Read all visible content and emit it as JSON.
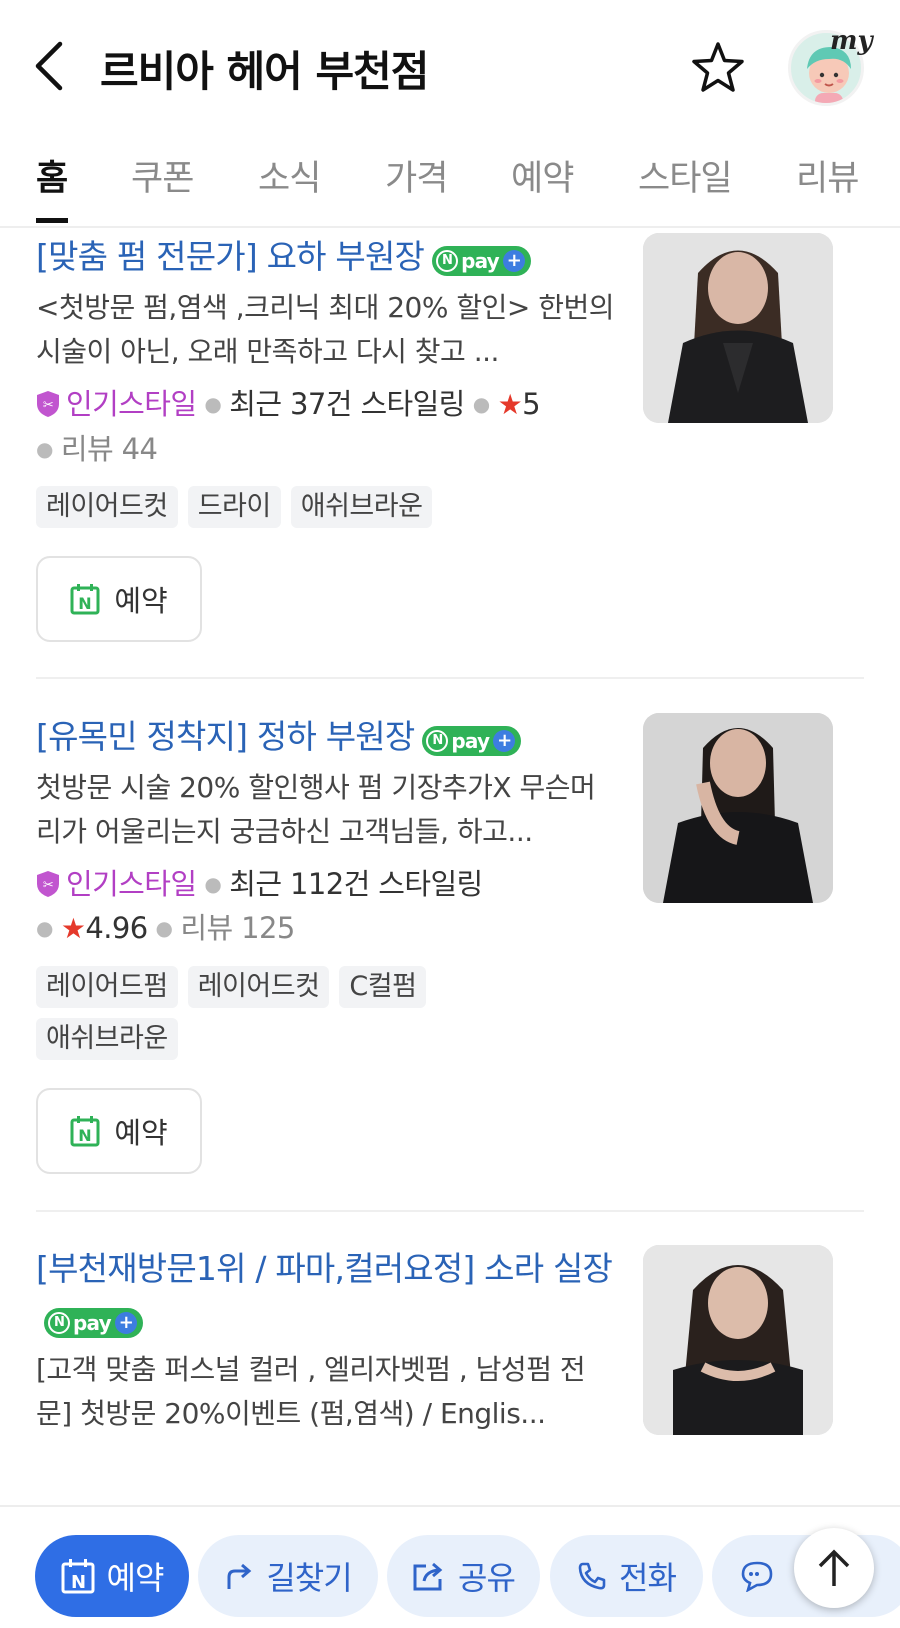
{
  "header": {
    "title": "르비아 헤어 부천점",
    "my_label": "my",
    "icons": [
      "back-arrow-icon",
      "star-outline-icon",
      "profile-avatar-icon"
    ]
  },
  "tabs": [
    {
      "label": "홈",
      "active": true
    },
    {
      "label": "쿠폰"
    },
    {
      "label": "소식"
    },
    {
      "label": "가격"
    },
    {
      "label": "예약"
    },
    {
      "label": "스타일"
    },
    {
      "label": "리뷰"
    }
  ],
  "npay": {
    "label": "pay",
    "n": "N",
    "plus": "+"
  },
  "designers": [
    {
      "title": "[맞춤 펌 전문가] 요하 부원장",
      "description": "<첫방문 펌,염색 ,크리닉 최대 20% 할인> 한번의 시술이 아닌, 오래 만족하고 다시 찾고 ...",
      "popular": "인기스타일",
      "recent": "최근 37건 스타일링",
      "rating": "5",
      "reviews": "리뷰 44",
      "tags": [
        "레이어드컷",
        "드라이",
        "애쉬브라운"
      ],
      "reserve_label": "예약"
    },
    {
      "title": "[유목민 정착지] 정하 부원장",
      "description": "첫방문 시술 20% 할인행사 펌 기장추가X 무슨머리가 어울리는지 궁금하신 고객님들, 하고...",
      "popular": "인기스타일",
      "recent": "최근 112건 스타일링",
      "rating": "4.96",
      "reviews": "리뷰 125",
      "tags": [
        "레이어드펌",
        "레이어드컷",
        "C컬펌",
        "애쉬브라운"
      ],
      "reserve_label": "예약"
    },
    {
      "title": "[부천재방문1위 / 파마,컬러요정] 소라 실장",
      "description": "[고객 맞춤 퍼스널 컬러 , 엘리자벳펌 , 남성펌 전문] 첫방문 20%이벤트 (펌,염색) / Englis..."
    }
  ],
  "bottom_bar": {
    "reserve": "예약",
    "directions": "길찾기",
    "share": "공유",
    "call": "전화"
  },
  "colors": {
    "accent_blue": "#2f6ee5",
    "title_blue": "#2a63b6",
    "npay_green": "#2fb257",
    "popular_purple": "#b23fc4",
    "star_red": "#e5392b"
  }
}
